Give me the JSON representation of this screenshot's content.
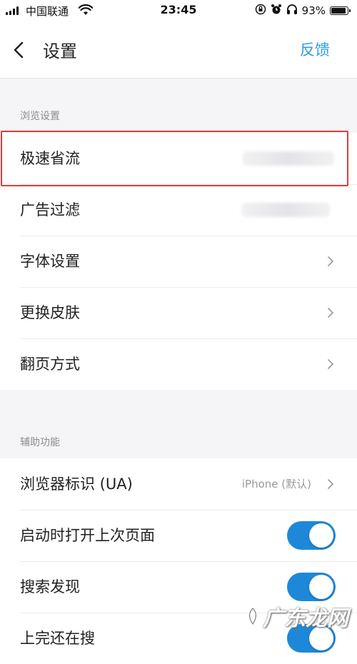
{
  "status_bar": {
    "carrier": "中国联通",
    "time": "23:45",
    "battery": "93%",
    "battery_level": 0.93
  },
  "nav": {
    "title": "设置",
    "feedback": "反馈"
  },
  "browsing": {
    "header": "浏览设置",
    "items": [
      {
        "label": "极速省流"
      },
      {
        "label": "广告过滤"
      },
      {
        "label": "字体设置"
      },
      {
        "label": "更换皮肤"
      },
      {
        "label": "翻页方式"
      }
    ]
  },
  "assist": {
    "header": "辅助功能",
    "items": [
      {
        "label": "浏览器标识 (UA)",
        "value": "iPhone (默认)"
      },
      {
        "label": "启动时打开上次页面",
        "toggle": true
      },
      {
        "label": "搜索发现",
        "toggle": true
      },
      {
        "label": "上完还在搜",
        "toggle": true
      }
    ]
  },
  "watermark": {
    "text": "广东龙网"
  },
  "colors": {
    "accent": "#2f9cdc",
    "toggle_on": "#1e88d8",
    "highlight": "#e53a3a"
  }
}
